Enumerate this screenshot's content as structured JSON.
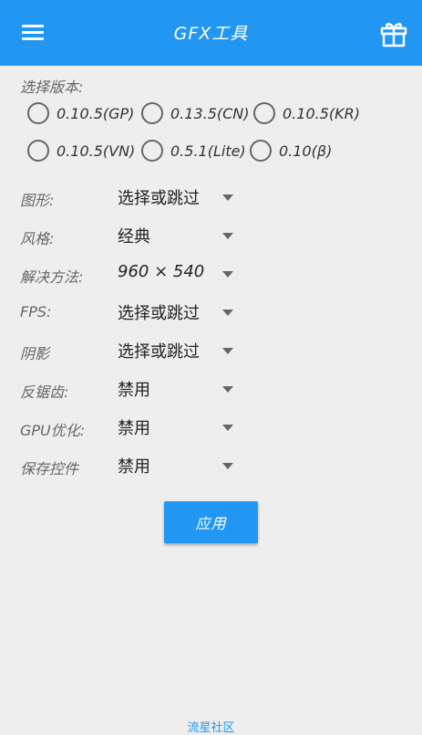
{
  "appbar": {
    "title": "GFX工具",
    "menu_icon": "menu-icon",
    "gift_icon": "gift-icon"
  },
  "version": {
    "label": "选择版本:",
    "options": [
      "0.10.5(GP)",
      "0.13.5(CN)",
      "0.10.5(KR)",
      "0.10.5(VN)",
      "0.5.1(Lite)",
      "0.10(β)"
    ],
    "selected": null
  },
  "settings": [
    {
      "label": "图形:",
      "value": "选择或跳过"
    },
    {
      "label": "风格:",
      "value": "经典"
    },
    {
      "label": "解决方法:",
      "value": "960 × 540"
    },
    {
      "label": "FPS:",
      "value": "选择或跳过"
    },
    {
      "label": "阴影",
      "value": "选择或跳过"
    },
    {
      "label": "反锯齿:",
      "value": "禁用"
    },
    {
      "label": "GPU优化:",
      "value": "禁用"
    },
    {
      "label": "保存控件",
      "value": "禁用"
    }
  ],
  "apply_button": "应用",
  "footer_link": "流星社区",
  "colors": {
    "primary": "#2196f3",
    "background": "#eeeeee",
    "label": "#666666",
    "value": "#222222"
  }
}
